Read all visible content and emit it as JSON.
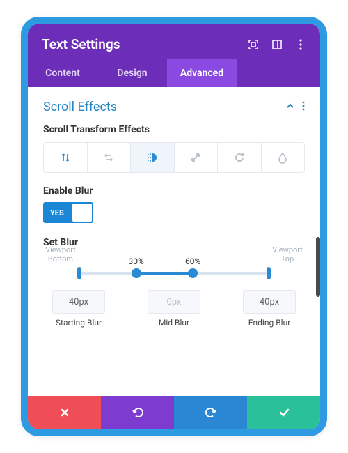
{
  "header": {
    "title": "Text Settings",
    "icons": {
      "expand": "expand-icon",
      "layout": "panel-icon",
      "menu": "kebab-icon"
    }
  },
  "tabs": [
    {
      "label": "Content",
      "active": false
    },
    {
      "label": "Design",
      "active": false
    },
    {
      "label": "Advanced",
      "active": true
    }
  ],
  "section": {
    "title": "Scroll Effects",
    "transform_label": "Scroll Transform Effects",
    "effects": [
      {
        "name": "vertical-motion",
        "active": false,
        "blue": true
      },
      {
        "name": "horizontal-motion",
        "active": false,
        "blue": false
      },
      {
        "name": "blur",
        "active": true,
        "blue": true
      },
      {
        "name": "scale",
        "active": false,
        "blue": false
      },
      {
        "name": "rotate",
        "active": false,
        "blue": false
      },
      {
        "name": "fade",
        "active": false,
        "blue": false
      }
    ],
    "enable_label": "Enable Blur",
    "enable_value": "YES",
    "set_label": "Set Blur",
    "viewport_bottom": "Viewport Bottom",
    "viewport_top": "Viewport Top",
    "handles": [
      {
        "percent_label": "30%",
        "pos": 30
      },
      {
        "percent_label": "60%",
        "pos": 60
      }
    ],
    "values": [
      {
        "value": "40px",
        "name": "Starting Blur"
      },
      {
        "value": "0px",
        "name": "Mid Blur"
      },
      {
        "value": "40px",
        "name": "Ending Blur"
      }
    ]
  },
  "footer": {
    "cancel": "cancel",
    "undo": "undo",
    "redo": "redo",
    "save": "save"
  },
  "colors": {
    "frame": "#2e9ae1",
    "header": "#6c2eb9",
    "tab_active": "#8a49e0",
    "accent": "#2a8bd4",
    "cancel": "#ef4e57",
    "undo": "#7e3bd0",
    "redo": "#2b87d3",
    "save": "#2ac19a"
  }
}
